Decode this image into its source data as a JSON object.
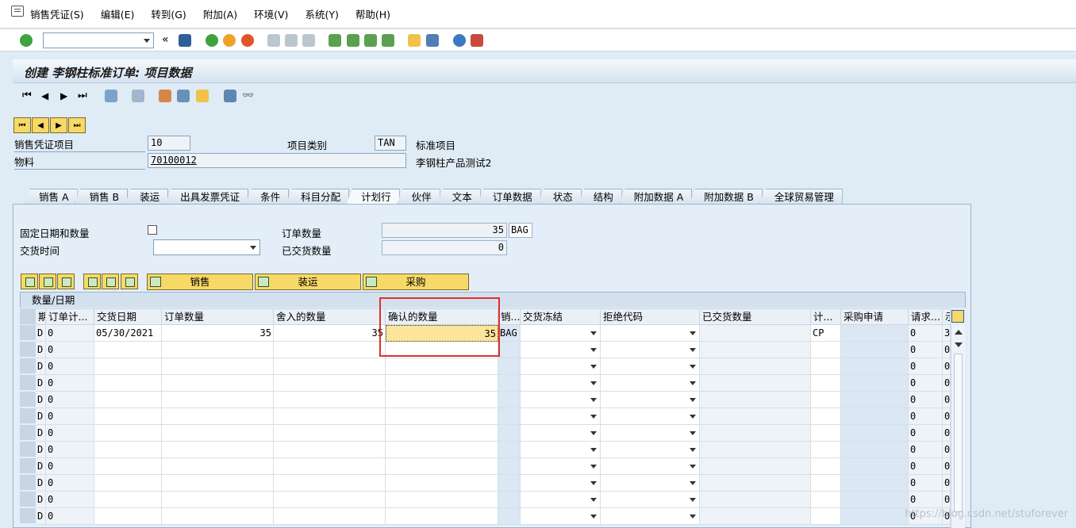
{
  "menubar": {
    "items": [
      "销售凭证(S)",
      "编辑(E)",
      "转到(G)",
      "附加(A)",
      "环境(V)",
      "系统(Y)",
      "帮助(H)"
    ]
  },
  "window": {
    "title": "创建 李钢柱标准订单: 项目数据"
  },
  "header": {
    "item_label": "销售凭证项目",
    "item_value": "10",
    "category_label": "项目类别",
    "category_value": "TAN",
    "category_desc": "标准项目",
    "material_label": "物料",
    "material_value": "70100012",
    "material_desc": "李钢柱产品测试2"
  },
  "tabs": [
    "销售 A",
    "销售 B",
    "装运",
    "出具发票凭证",
    "条件",
    "科目分配",
    "计划行",
    "伙伴",
    "文本",
    "订单数据",
    "状态",
    "结构",
    "附加数据 A",
    "附加数据 B",
    "全球贸易管理"
  ],
  "active_tab": "计划行",
  "schedule": {
    "fixed_label": "固定日期和数量",
    "delivery_time_label": "交货时间",
    "order_qty_label": "订单数量",
    "order_qty_value": "35",
    "order_qty_unit": "BAG",
    "delivered_qty_label": "已交货数量",
    "delivered_qty_value": "0"
  },
  "buttons": {
    "sales": "销售",
    "shipping": "装运",
    "purchasing": "采购"
  },
  "grid": {
    "title": "数量/日期",
    "columns": [
      "期",
      "订单计...",
      "交货日期",
      "订单数量",
      "舍入的数量",
      "确认的数量",
      "销...",
      "交货冻结",
      "拒绝代码",
      "已交货数量",
      "计...",
      "采购申请",
      "请求...",
      "示"
    ],
    "first_row": {
      "col0": "D",
      "col1": "0",
      "date": "05/30/2021",
      "order_qty": "35",
      "rounded_qty": "35",
      "confirmed_qty": "35",
      "unit": "BAG",
      "plan_type": "CP",
      "request": "0",
      "extra": "3"
    },
    "empty_row": {
      "col0": "D",
      "col1": "0",
      "request": "0",
      "extra": "0"
    }
  },
  "watermark": "https://blog.csdn.net/stuforever"
}
